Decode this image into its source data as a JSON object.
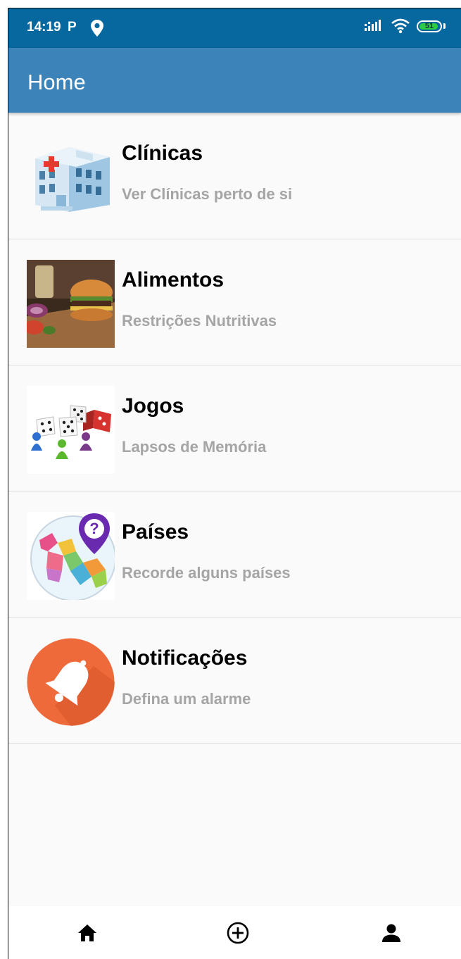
{
  "status_bar": {
    "time": "14:19",
    "parking_glyph": "P",
    "signal_text": ":ıll",
    "battery_level": "51",
    "icons": [
      "location-pin-icon",
      "signal-icon",
      "wifi-icon",
      "battery-icon"
    ]
  },
  "app_bar": {
    "title": "Home"
  },
  "menu": {
    "items": [
      {
        "title": "Clínicas",
        "subtitle": "Ver Clínicas perto de si",
        "image": "hospital-building-image"
      },
      {
        "title": "Alimentos",
        "subtitle": "Restrições Nutritivas",
        "image": "burger-food-image"
      },
      {
        "title": "Jogos",
        "subtitle": "Lapsos de Memória",
        "image": "dice-and-pawns-image"
      },
      {
        "title": "Países",
        "subtitle": "Recorde alguns países",
        "image": "europe-map-question-image"
      },
      {
        "title": "Notificações",
        "subtitle": "Defina um alarme",
        "image": "bell-icon"
      }
    ]
  },
  "bottom_nav": {
    "items": [
      "home-icon",
      "add-circle-icon",
      "person-icon"
    ]
  },
  "colors": {
    "status_bar": "#06689e",
    "app_bar": "#3b83b8",
    "background": "#fafafa",
    "subtitle": "#a5a5a5",
    "bell_orange": "#ee6a3b"
  }
}
